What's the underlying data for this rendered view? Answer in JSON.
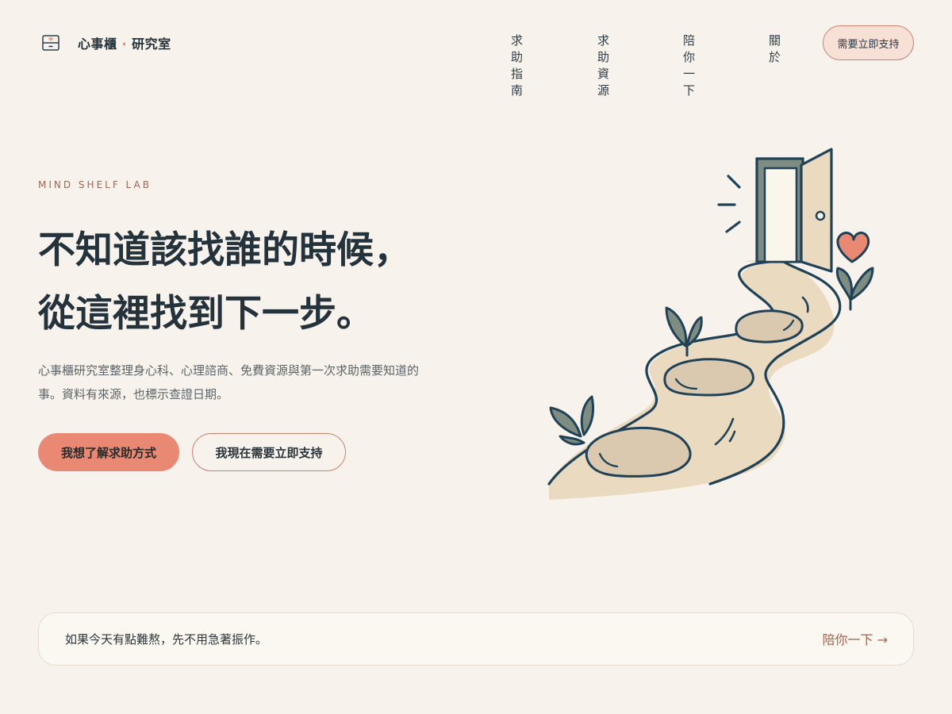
{
  "header": {
    "brand_name": "心事櫃",
    "brand_sep": "·",
    "brand_suffix": "研究室",
    "nav": [
      "求助指南",
      "求助資源",
      "陪你一下",
      "關於"
    ],
    "support_button": "需要立即支持"
  },
  "hero": {
    "eyebrow": "MIND SHELF LAB",
    "headline_line1": "不知道該找誰的時候，",
    "headline_line2": "從這裡找到下一步。",
    "lead": "心事櫃研究室整理身心科、心理諮商、免費資源與第一次求助需要知道的事。資料有來源，也標示查證日期。",
    "primary_button": "我想了解求助方式",
    "secondary_button": "我現在需要立即支持"
  },
  "banner": {
    "text": "如果今天有點難熬，先不用急著振作。",
    "link": "陪你一下 →"
  },
  "colors": {
    "background": "#f7f3ec",
    "accent": "#e98873",
    "ink": "#24323b",
    "path": "#eadbc0",
    "leaf": "#7f8c82"
  },
  "icons": [
    "cabinet-icon",
    "door-illustration",
    "heart-icon",
    "leaf-icon"
  ]
}
